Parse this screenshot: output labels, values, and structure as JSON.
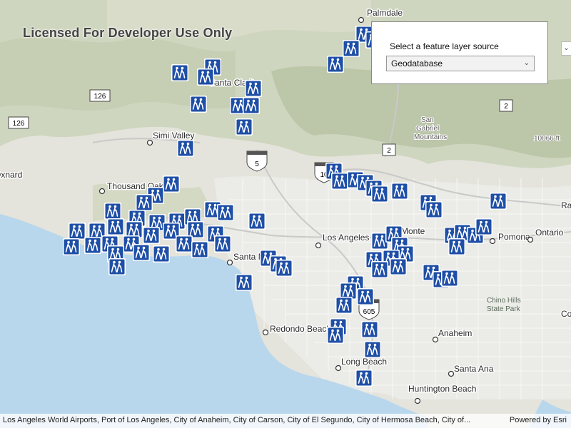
{
  "watermark": "Licensed For Developer Use Only",
  "panel": {
    "label": "Select a feature layer source",
    "selected": "Geodatabase"
  },
  "attribution": {
    "sources": "Los Angeles World Airports, Port of Los Angeles, City of Anaheim, City of Carson, City of El Segundo, City of Hermosa Beach, City of...",
    "powered": "Powered by Esri"
  },
  "cities": [
    {
      "name": "Palmdale"
    },
    {
      "name": "Simi Valley"
    },
    {
      "name": "Thousand Oaks"
    },
    {
      "name": "Santa Clarita"
    },
    {
      "name": "Los Angeles"
    },
    {
      "name": "El Monte"
    },
    {
      "name": "Pomona"
    },
    {
      "name": "Ontario"
    },
    {
      "name": "Redondo Beach"
    },
    {
      "name": "Anaheim"
    },
    {
      "name": "Long Beach"
    },
    {
      "name": "Santa Ana"
    },
    {
      "name": "Huntington Beach"
    },
    {
      "name": "Santa Monica"
    },
    {
      "name": "Oxnard"
    },
    {
      "name": "Rancho Cucamonga"
    },
    {
      "name": "Corona"
    }
  ],
  "highway_shields": [
    {
      "label": "126"
    },
    {
      "label": "126"
    },
    {
      "label": "2"
    },
    {
      "label": "2"
    },
    {
      "label": "5"
    },
    {
      "label": "10"
    },
    {
      "label": "605"
    }
  ],
  "terrain_labels": {
    "mountains": "San Gabriel Mountains",
    "peak": "10066 ft",
    "park": "Chino Hills State Park"
  },
  "colors": {
    "water": "#b9d7ec",
    "land": "#e9e7dd",
    "urban": "#ececec",
    "marker": "#1f4fa6"
  },
  "marker_icon": "hiker-icon"
}
